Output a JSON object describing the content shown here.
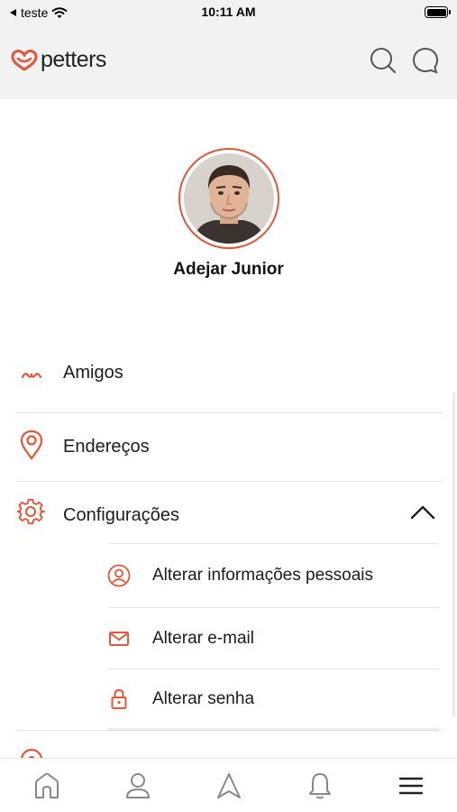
{
  "status_bar": {
    "carrier": "teste",
    "time": "10:11 AM"
  },
  "header": {
    "logo_text": "petters",
    "search_icon": "search-icon",
    "chat_icon": "chat-bubble-icon"
  },
  "profile": {
    "name": "Adejar Junior"
  },
  "menu": {
    "items": [
      {
        "label": "Amigos",
        "icon": "friends-icon"
      },
      {
        "label": "Endereços",
        "icon": "location-pin-icon"
      },
      {
        "label": "Configurações",
        "icon": "gear-icon",
        "expanded": true
      }
    ],
    "settings_subitems": [
      {
        "label": "Alterar informações pessoais",
        "icon": "user-circle-icon"
      },
      {
        "label": "Alterar e-mail",
        "icon": "mail-icon"
      },
      {
        "label": "Alterar senha",
        "icon": "lock-icon"
      }
    ]
  },
  "tab_bar": {
    "tabs": [
      "home-icon",
      "profile-icon",
      "navigation-icon",
      "bell-icon",
      "menu-icon"
    ],
    "active": "menu-icon"
  },
  "colors": {
    "accent": "#e4553a",
    "header_bg": "#f2f2f2",
    "text": "#1c1c1c"
  }
}
